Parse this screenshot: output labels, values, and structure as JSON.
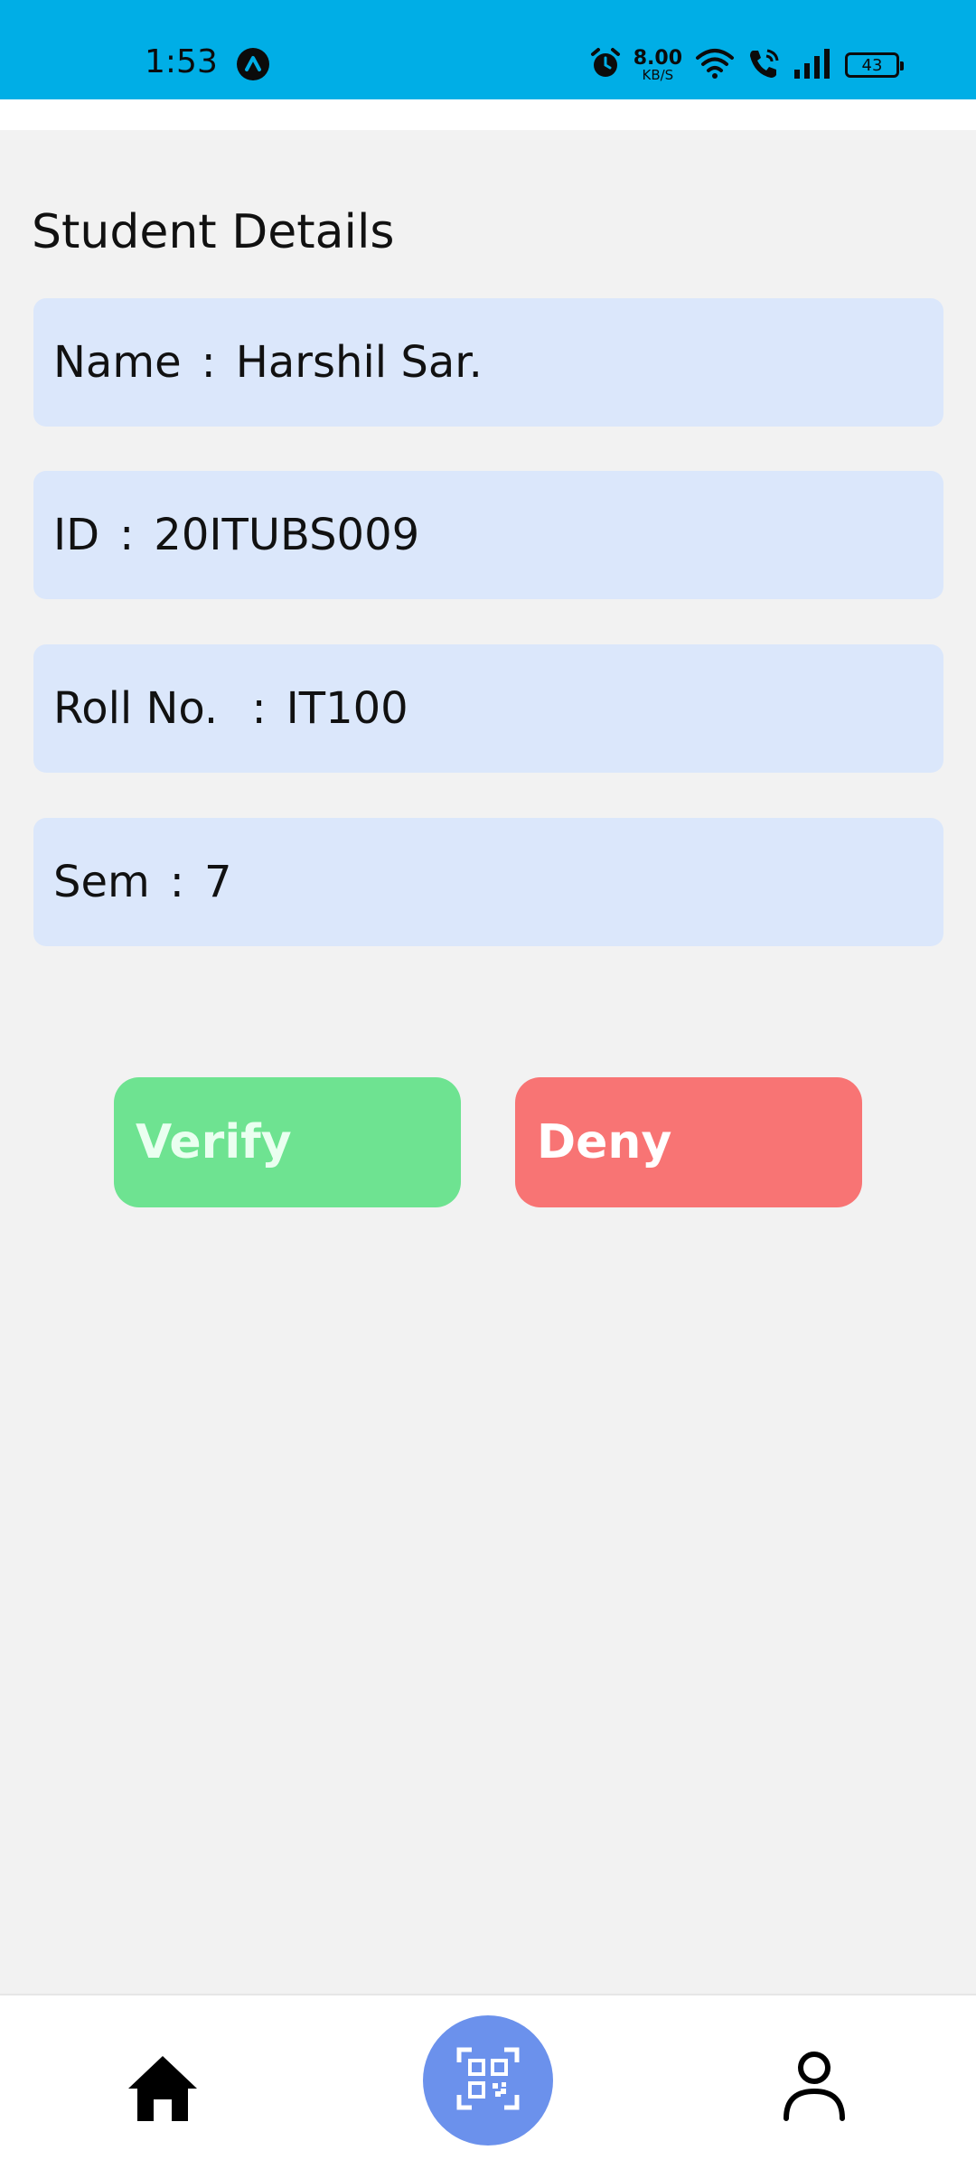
{
  "status_bar": {
    "time": "1:53",
    "net_speed_value": "8.00",
    "net_speed_unit": "KB/S",
    "battery": "43",
    "icons": [
      "app-notification-icon",
      "alarm-icon",
      "wifi-icon",
      "wifi-calling-icon",
      "signal-icon",
      "battery-icon"
    ],
    "background_color": "#00aee6"
  },
  "page": {
    "title": "Student Details"
  },
  "details": [
    {
      "label": "Name",
      "separator": ":",
      "value": "Harshil Sar."
    },
    {
      "label": "ID",
      "separator": ":",
      "value": "20ITUBS009"
    },
    {
      "label": "Roll No. ",
      "separator": ":",
      "value": "IT100"
    },
    {
      "label": "Sem",
      "separator": ":",
      "value": "7"
    }
  ],
  "actions": {
    "verify_label": "Verify",
    "deny_label": "Deny",
    "verify_color": "#6ee391",
    "deny_color": "#f87474"
  },
  "bottom_nav": {
    "items": [
      "home-icon",
      "qr-scan-icon",
      "profile-icon"
    ],
    "scan_button_color": "#6b91ec"
  }
}
